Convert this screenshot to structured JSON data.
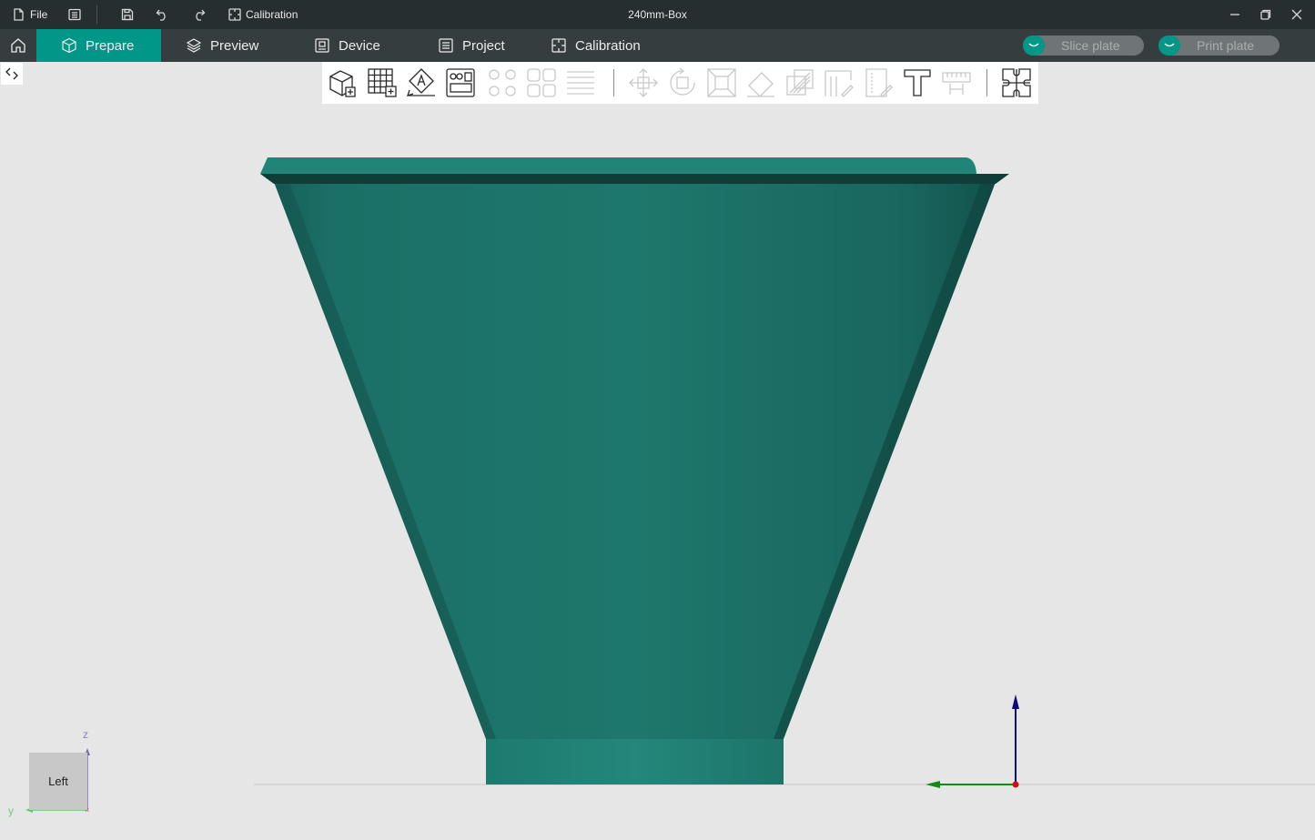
{
  "titlebar": {
    "file_label": "File",
    "calibration_label": "Calibration",
    "document_title": "240mm-Box"
  },
  "nav": {
    "tabs": [
      {
        "label": "Prepare",
        "active": true,
        "icon": "cube-icon"
      },
      {
        "label": "Preview",
        "active": false,
        "icon": "layers-icon"
      },
      {
        "label": "Device",
        "active": false,
        "icon": "device-icon"
      },
      {
        "label": "Project",
        "active": false,
        "icon": "project-icon"
      },
      {
        "label": "Calibration",
        "active": false,
        "icon": "calibration-icon"
      }
    ],
    "slice_plate_label": "Slice plate",
    "print_plate_label": "Print plate"
  },
  "toolbar": {
    "tools": [
      {
        "name": "add-object",
        "enabled": true
      },
      {
        "name": "add-plate",
        "enabled": true
      },
      {
        "name": "auto-orient",
        "enabled": true
      },
      {
        "name": "arrange",
        "enabled": true
      },
      {
        "name": "split-to-objects",
        "enabled": false
      },
      {
        "name": "split-to-parts",
        "enabled": false
      },
      {
        "name": "variable-layer-height",
        "enabled": false
      },
      {
        "name": "move",
        "enabled": false
      },
      {
        "name": "rotate",
        "enabled": false
      },
      {
        "name": "scale",
        "enabled": false
      },
      {
        "name": "lay-on-face",
        "enabled": false
      },
      {
        "name": "cut",
        "enabled": false
      },
      {
        "name": "support-painting",
        "enabled": false
      },
      {
        "name": "seam-painting",
        "enabled": false
      },
      {
        "name": "text",
        "enabled": true
      },
      {
        "name": "measure",
        "enabled": false
      },
      {
        "name": "assembly",
        "enabled": true
      }
    ]
  },
  "viewport": {
    "view_cube_label": "Left",
    "axis_z_label": "z",
    "axis_y_label": "y",
    "model_color": "#1e7a6e",
    "accent_color": "#009688"
  }
}
